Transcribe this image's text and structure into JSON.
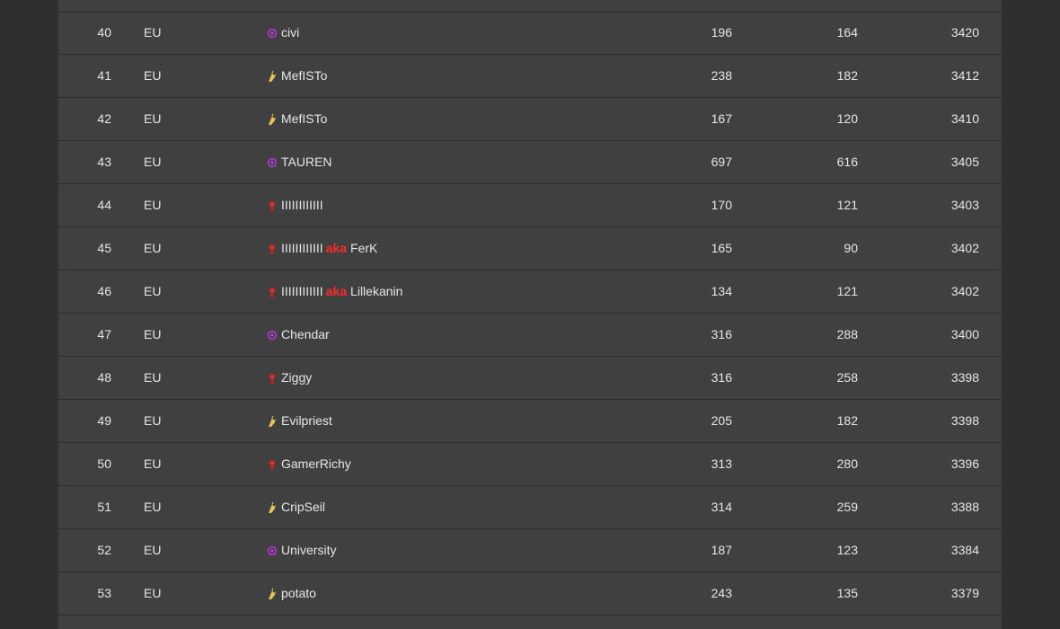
{
  "colors": {
    "background": "#2f2f2f",
    "panel": "#404040",
    "row_divider": "#2c2c2c",
    "text": "#e6e6e6",
    "aka": "#ff2a2a",
    "race_protoss": "#e8c35a",
    "race_zerg": "#8a3fa0",
    "race_terran": "#a52a2a"
  },
  "rows": [
    {
      "rank": "40",
      "region": "EU",
      "race_icon": "zerg-icon",
      "name": "civi",
      "games": "196",
      "wins": "164",
      "mmr": "3420"
    },
    {
      "rank": "41",
      "region": "EU",
      "race_icon": "protoss-icon",
      "name": "MefISTo",
      "games": "238",
      "wins": "182",
      "mmr": "3412"
    },
    {
      "rank": "42",
      "region": "EU",
      "race_icon": "protoss-icon",
      "name": "MefISTo",
      "games": "167",
      "wins": "120",
      "mmr": "3410"
    },
    {
      "rank": "43",
      "region": "EU",
      "race_icon": "zerg-icon",
      "name": "TAUREN",
      "games": "697",
      "wins": "616",
      "mmr": "3405"
    },
    {
      "rank": "44",
      "region": "EU",
      "race_icon": "terran-icon",
      "name": "IIIIIIIIIIII",
      "games": "170",
      "wins": "121",
      "mmr": "3403"
    },
    {
      "rank": "45",
      "region": "EU",
      "race_icon": "terran-icon",
      "name": "IIIIIIIIIIII",
      "aka": "aka",
      "alias": "FerK",
      "games": "165",
      "wins": "90",
      "mmr": "3402"
    },
    {
      "rank": "46",
      "region": "EU",
      "race_icon": "terran-icon",
      "name": "IIIIIIIIIIII",
      "aka": "aka",
      "alias": "Lillekanin",
      "games": "134",
      "wins": "121",
      "mmr": "3402"
    },
    {
      "rank": "47",
      "region": "EU",
      "race_icon": "zerg-icon",
      "name": "Chendar",
      "games": "316",
      "wins": "288",
      "mmr": "3400"
    },
    {
      "rank": "48",
      "region": "EU",
      "race_icon": "terran-icon",
      "name": "Ziggy",
      "games": "316",
      "wins": "258",
      "mmr": "3398"
    },
    {
      "rank": "49",
      "region": "EU",
      "race_icon": "protoss-icon",
      "name": "Evilpriest",
      "games": "205",
      "wins": "182",
      "mmr": "3398"
    },
    {
      "rank": "50",
      "region": "EU",
      "race_icon": "terran-icon",
      "name": "GamerRichy",
      "games": "313",
      "wins": "280",
      "mmr": "3396"
    },
    {
      "rank": "51",
      "region": "EU",
      "race_icon": "protoss-icon",
      "name": "CripSeil",
      "games": "314",
      "wins": "259",
      "mmr": "3388"
    },
    {
      "rank": "52",
      "region": "EU",
      "race_icon": "zerg-icon",
      "name": "University",
      "games": "187",
      "wins": "123",
      "mmr": "3384"
    },
    {
      "rank": "53",
      "region": "EU",
      "race_icon": "protoss-icon",
      "name": "potato",
      "games": "243",
      "wins": "135",
      "mmr": "3379"
    }
  ]
}
